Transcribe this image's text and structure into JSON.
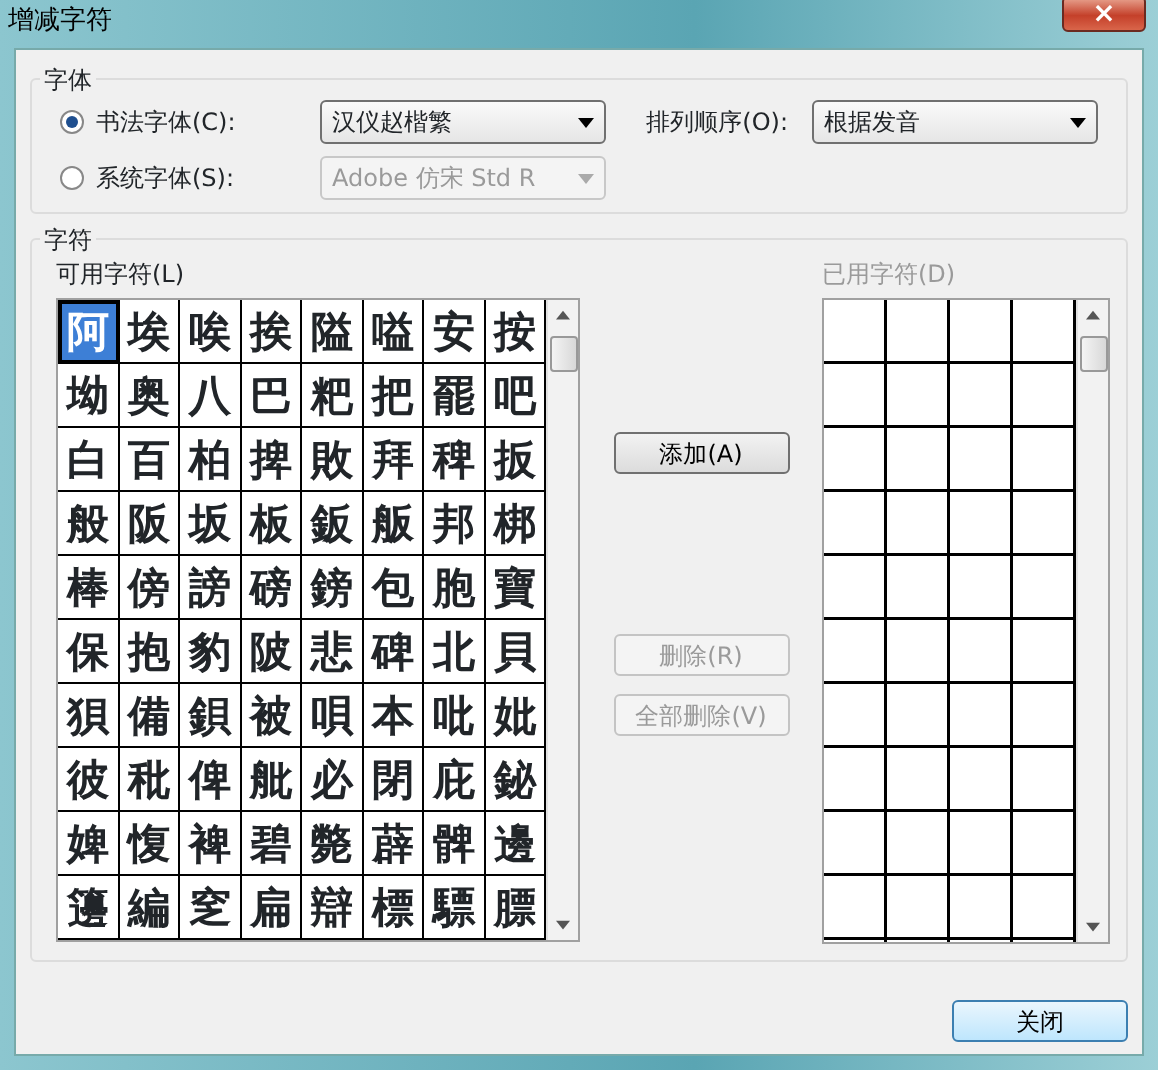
{
  "window": {
    "title": "增减字符",
    "close": "×"
  },
  "font_group": {
    "title": "字体",
    "options": [
      {
        "label": "书法字体(C):",
        "selected": true,
        "value": "汉仪赵楷繁",
        "disabled": false
      },
      {
        "label": "系统字体(S):",
        "selected": false,
        "value": "Adobe 仿宋 Std R",
        "disabled": true
      }
    ],
    "sort": {
      "label": "排列顺序(O):",
      "value": "根据发音"
    }
  },
  "chars_group": {
    "title": "字符",
    "available": {
      "label": "可用字符(L)",
      "rows": [
        [
          {
            "char": "阿",
            "selected": true
          },
          {
            "char": "埃",
            "selected": false
          },
          {
            "char": "唉",
            "selected": false
          },
          {
            "char": "挨",
            "selected": false
          },
          {
            "char": "隘",
            "selected": false
          },
          {
            "char": "嗌",
            "selected": false
          },
          {
            "char": "安",
            "selected": false
          },
          {
            "char": "按",
            "selected": false
          }
        ],
        [
          {
            "char": "坳",
            "selected": false
          },
          {
            "char": "奥",
            "selected": false
          },
          {
            "char": "八",
            "selected": false
          },
          {
            "char": "巴",
            "selected": false
          },
          {
            "char": "粑",
            "selected": false
          },
          {
            "char": "把",
            "selected": false
          },
          {
            "char": "罷",
            "selected": false
          },
          {
            "char": "吧",
            "selected": false
          }
        ],
        [
          {
            "char": "白",
            "selected": false
          },
          {
            "char": "百",
            "selected": false
          },
          {
            "char": "柏",
            "selected": false
          },
          {
            "char": "捭",
            "selected": false
          },
          {
            "char": "敗",
            "selected": false
          },
          {
            "char": "拜",
            "selected": false
          },
          {
            "char": "稗",
            "selected": false
          },
          {
            "char": "扳",
            "selected": false
          }
        ],
        [
          {
            "char": "般",
            "selected": false
          },
          {
            "char": "阪",
            "selected": false
          },
          {
            "char": "坂",
            "selected": false
          },
          {
            "char": "板",
            "selected": false
          },
          {
            "char": "鈑",
            "selected": false
          },
          {
            "char": "舨",
            "selected": false
          },
          {
            "char": "邦",
            "selected": false
          },
          {
            "char": "梆",
            "selected": false
          }
        ],
        [
          {
            "char": "棒",
            "selected": false
          },
          {
            "char": "傍",
            "selected": false
          },
          {
            "char": "謗",
            "selected": false
          },
          {
            "char": "磅",
            "selected": false
          },
          {
            "char": "鎊",
            "selected": false
          },
          {
            "char": "包",
            "selected": false
          },
          {
            "char": "胞",
            "selected": false
          },
          {
            "char": "寶",
            "selected": false
          }
        ],
        [
          {
            "char": "保",
            "selected": false
          },
          {
            "char": "抱",
            "selected": false
          },
          {
            "char": "豹",
            "selected": false
          },
          {
            "char": "陂",
            "selected": false
          },
          {
            "char": "悲",
            "selected": false
          },
          {
            "char": "碑",
            "selected": false
          },
          {
            "char": "北",
            "selected": false
          },
          {
            "char": "貝",
            "selected": false
          }
        ],
        [
          {
            "char": "狽",
            "selected": false
          },
          {
            "char": "備",
            "selected": false
          },
          {
            "char": "鋇",
            "selected": false
          },
          {
            "char": "被",
            "selected": false
          },
          {
            "char": "唄",
            "selected": false
          },
          {
            "char": "本",
            "selected": false
          },
          {
            "char": "吡",
            "selected": false
          },
          {
            "char": "妣",
            "selected": false
          }
        ],
        [
          {
            "char": "彼",
            "selected": false
          },
          {
            "char": "秕",
            "selected": false
          },
          {
            "char": "俾",
            "selected": false
          },
          {
            "char": "舭",
            "selected": false
          },
          {
            "char": "必",
            "selected": false
          },
          {
            "char": "閉",
            "selected": false
          },
          {
            "char": "庇",
            "selected": false
          },
          {
            "char": "鉍",
            "selected": false
          }
        ],
        [
          {
            "char": "婢",
            "selected": false
          },
          {
            "char": "愎",
            "selected": false
          },
          {
            "char": "裨",
            "selected": false
          },
          {
            "char": "碧",
            "selected": false
          },
          {
            "char": "斃",
            "selected": false
          },
          {
            "char": "薜",
            "selected": false
          },
          {
            "char": "髀",
            "selected": false
          },
          {
            "char": "邊",
            "selected": false
          }
        ],
        [
          {
            "char": "籩",
            "selected": false
          },
          {
            "char": "編",
            "selected": false
          },
          {
            "char": "窆",
            "selected": false
          },
          {
            "char": "扁",
            "selected": false
          },
          {
            "char": "辯",
            "selected": false
          },
          {
            "char": "標",
            "selected": false
          },
          {
            "char": "驃",
            "selected": false
          },
          {
            "char": "膘",
            "selected": false
          }
        ]
      ]
    },
    "buttons": [
      {
        "label": "添加(A)",
        "disabled": false
      },
      {
        "label": "删除(R)",
        "disabled": true
      },
      {
        "label": "全部删除(V)",
        "disabled": true
      }
    ],
    "used": {
      "label": "已用字符(D)",
      "disabled": true
    }
  },
  "close_button": {
    "label": "关闭"
  }
}
